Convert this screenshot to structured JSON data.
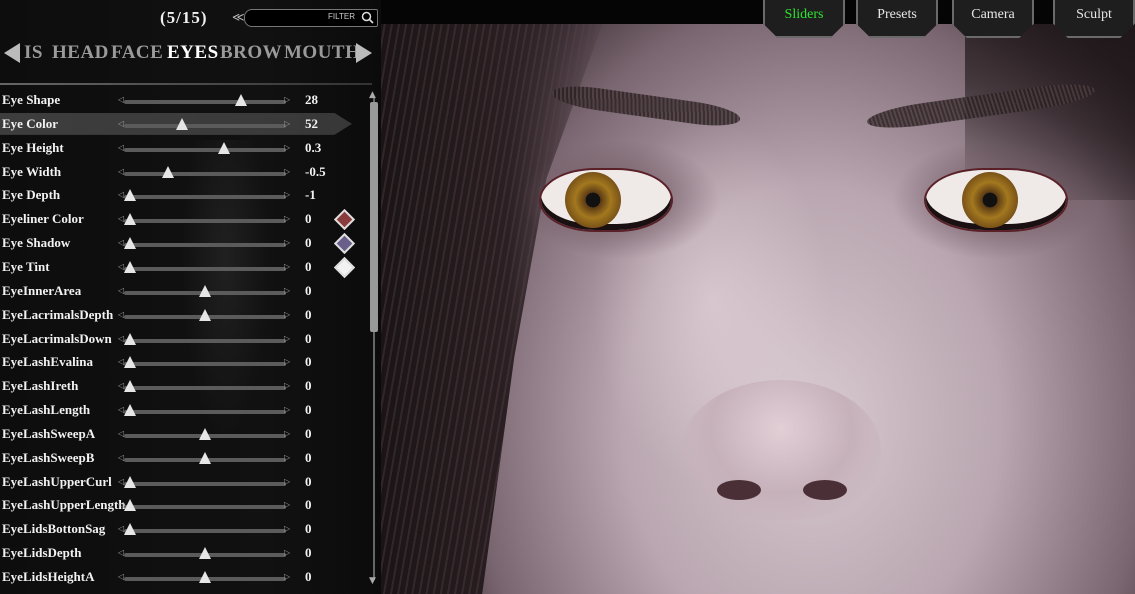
{
  "top_tabs": [
    {
      "label": "Sliders",
      "active": true
    },
    {
      "label": "Presets",
      "active": false
    },
    {
      "label": "Camera",
      "active": false
    },
    {
      "label": "Sculpt",
      "active": false
    }
  ],
  "header": {
    "counter": "(5/15)",
    "filter_label": "FILTER"
  },
  "categories": [
    {
      "label": "IS",
      "active": false
    },
    {
      "label": "HEAD",
      "active": false
    },
    {
      "label": "FACE",
      "active": false
    },
    {
      "label": "EYES",
      "active": true
    },
    {
      "label": "BROW",
      "active": false
    },
    {
      "label": "MOUTH",
      "active": false
    }
  ],
  "sliders": [
    {
      "label": "Eye Shape",
      "value": "28",
      "position": 0.72,
      "selected": false
    },
    {
      "label": "Eye Color",
      "value": "52",
      "position": 0.36,
      "selected": true
    },
    {
      "label": "Eye Height",
      "value": "0.3",
      "position": 0.62,
      "selected": false
    },
    {
      "label": "Eye Width",
      "value": "-0.5",
      "position": 0.27,
      "selected": false
    },
    {
      "label": "Eye Depth",
      "value": "-1",
      "position": 0.04,
      "selected": false
    },
    {
      "label": "Eyeliner Color",
      "value": "0",
      "position": 0.04,
      "selected": false,
      "swatch": "#8a3c3c"
    },
    {
      "label": "Eye Shadow",
      "value": "0",
      "position": 0.04,
      "selected": false,
      "swatch": "#6a5f8a"
    },
    {
      "label": "Eye Tint",
      "value": "0",
      "position": 0.04,
      "selected": false,
      "swatch": "#f2f2f2"
    },
    {
      "label": "EyeInnerArea",
      "value": "0",
      "position": 0.5,
      "selected": false
    },
    {
      "label": "EyeLacrimalsDepth",
      "value": "0",
      "position": 0.5,
      "selected": false
    },
    {
      "label": "EyeLacrimalsDown",
      "value": "0",
      "position": 0.04,
      "selected": false
    },
    {
      "label": "EyeLashEvalina",
      "value": "0",
      "position": 0.04,
      "selected": false
    },
    {
      "label": "EyeLashIreth",
      "value": "0",
      "position": 0.04,
      "selected": false
    },
    {
      "label": "EyeLashLength",
      "value": "0",
      "position": 0.04,
      "selected": false
    },
    {
      "label": "EyeLashSweepA",
      "value": "0",
      "position": 0.5,
      "selected": false
    },
    {
      "label": "EyeLashSweepB",
      "value": "0",
      "position": 0.5,
      "selected": false
    },
    {
      "label": "EyeLashUpperCurl",
      "value": "0",
      "position": 0.04,
      "selected": false
    },
    {
      "label": "EyeLashUpperLength",
      "value": "0",
      "position": 0.04,
      "selected": false
    },
    {
      "label": "EyeLidsBottonSag",
      "value": "0",
      "position": 0.04,
      "selected": false
    },
    {
      "label": "EyeLidsDepth",
      "value": "0",
      "position": 0.5,
      "selected": false
    },
    {
      "label": "EyeLidsHeightA",
      "value": "0",
      "position": 0.5,
      "selected": false
    }
  ],
  "colors": {
    "accent_active_tab": "#2ee52e",
    "panel_bg": "#0d0d0d"
  }
}
